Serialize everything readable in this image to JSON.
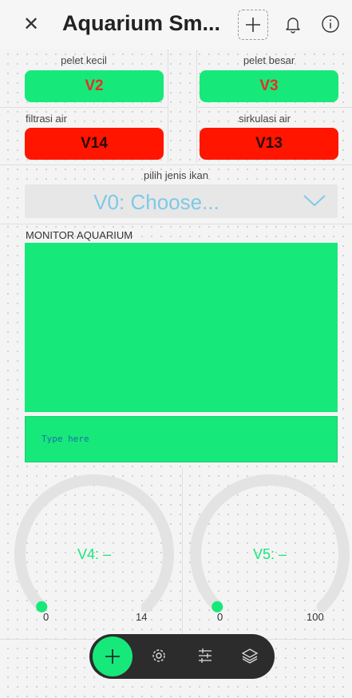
{
  "header": {
    "title": "Aquarium Sm...",
    "close_icon": "close-icon",
    "add_icon": "plus-icon",
    "notification_icon": "bell-icon",
    "info_icon": "info-icon"
  },
  "buttons": [
    {
      "label": "pelet kecil",
      "pin": "V2",
      "color": "#17e87a"
    },
    {
      "label": "pelet besar",
      "pin": "V3",
      "color": "#17e87a"
    },
    {
      "label": "filtrasi air",
      "pin": "V14",
      "color": "#ff1500"
    },
    {
      "label": "sirkulasi air",
      "pin": "V13",
      "color": "#ff1500"
    }
  ],
  "menu": {
    "label": "pilih jenis ikan",
    "value": "V0: Choose..."
  },
  "terminal": {
    "label": "MONITOR AQUARIUM",
    "input_placeholder": "Type here"
  },
  "gauges": [
    {
      "value_text": "V4: –",
      "min": "0",
      "max": "14",
      "level": 0
    },
    {
      "value_text": "V5: –",
      "min": "0",
      "max": "100",
      "level": 0
    }
  ],
  "dock": {
    "items": [
      "plus-icon",
      "gear-icon",
      "sliders-icon",
      "layers-icon"
    ]
  },
  "colors": {
    "accent_green": "#17e87a",
    "off_red": "#ff1500",
    "menu_text": "#7fc9e6",
    "gauge_track": "#e3e3e3"
  }
}
